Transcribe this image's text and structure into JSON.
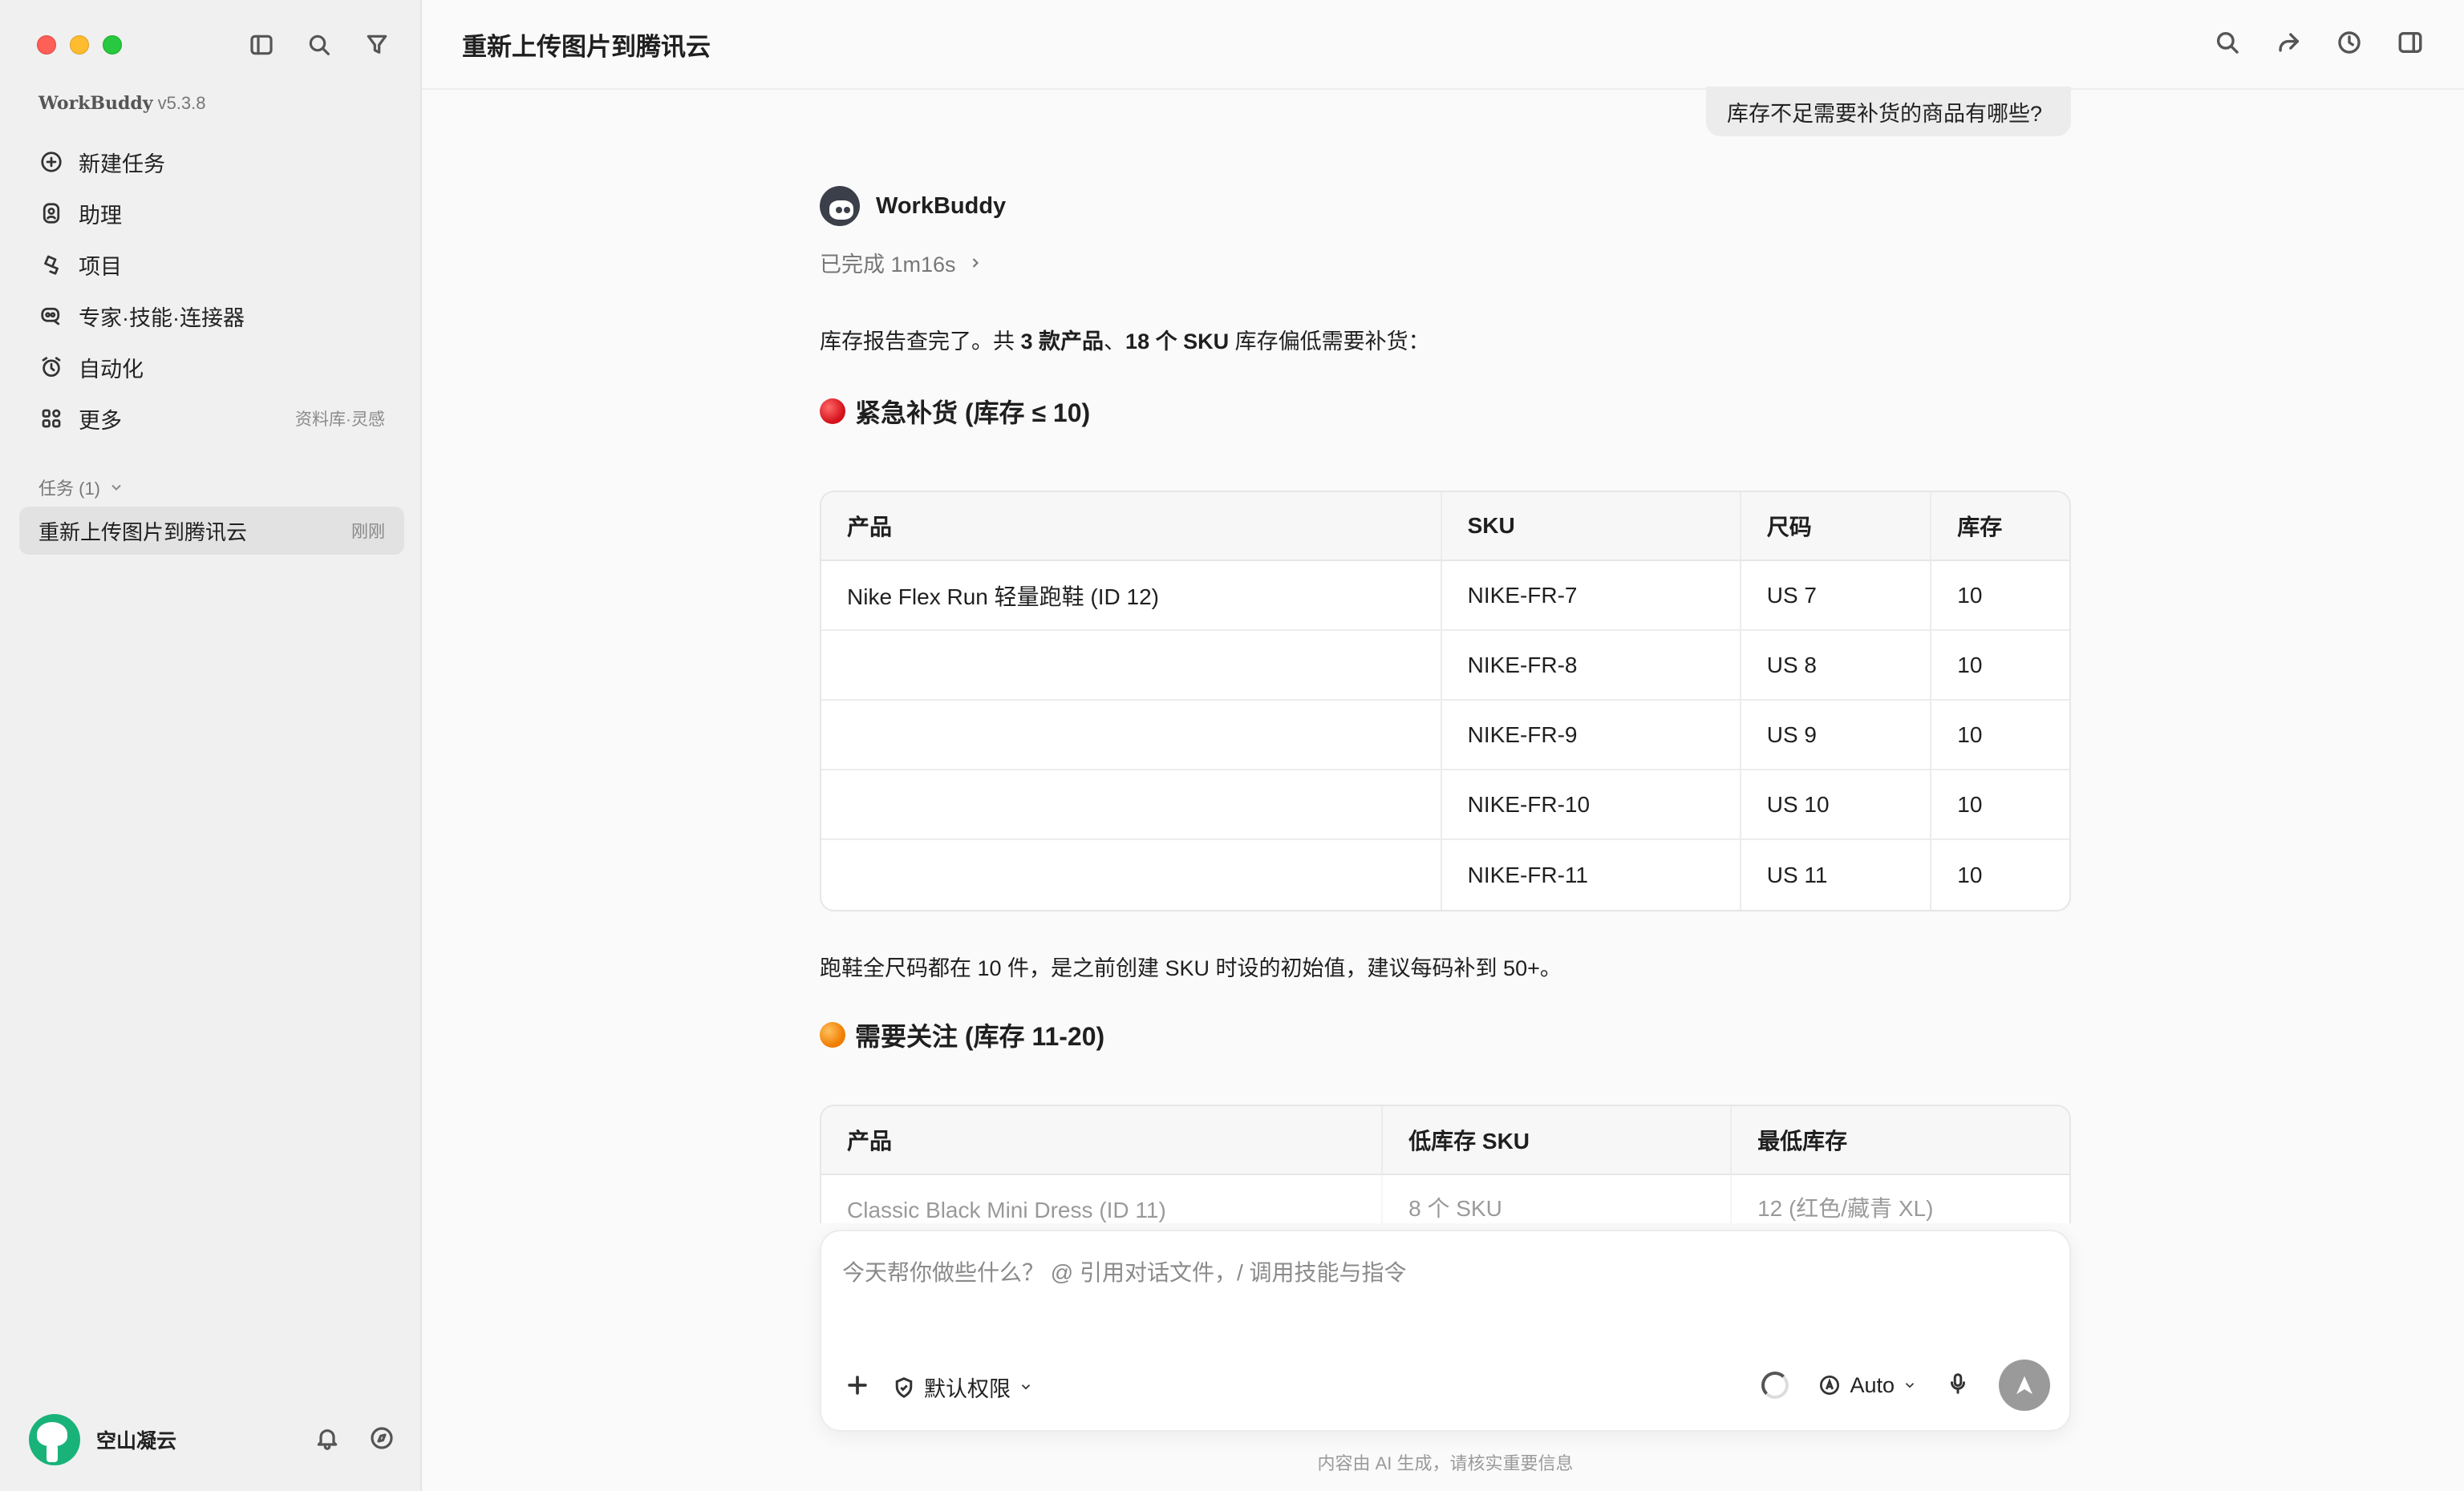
{
  "window": {
    "title": "重新上传图片到腾讯云"
  },
  "sidebar": {
    "brand": "WorkBuddy",
    "version": "v5.3.8",
    "nav": [
      {
        "label": "新建任务",
        "icon": "plus-circle-icon"
      },
      {
        "label": "助理",
        "icon": "assistant-icon"
      },
      {
        "label": "项目",
        "icon": "project-icon"
      },
      {
        "label": "专家·技能·连接器",
        "icon": "expert-icon"
      },
      {
        "label": "自动化",
        "icon": "alarm-clock-icon"
      },
      {
        "label": "更多",
        "icon": "apps-icon",
        "note": "资料库·灵感"
      }
    ],
    "tasks_header": "任务 (1)",
    "tasks": [
      {
        "label": "重新上传图片到腾讯云",
        "time": "刚刚"
      }
    ],
    "user": {
      "name": "空山凝云"
    }
  },
  "chat": {
    "user_message": "库存不足需要补货的商品有哪些?",
    "bot_name": "WorkBuddy",
    "status": "已完成 1m16s",
    "intro": {
      "pre": "库存报告查完了。共 ",
      "b1": "3 款产品",
      "mid": "、",
      "b2": "18 个 SKU",
      "post": " 库存偏低需要补货："
    },
    "section1": {
      "title": "紧急补货 (库存 ≤ 10)",
      "headers": [
        "产品",
        "SKU",
        "尺码",
        "库存"
      ],
      "rows": [
        [
          "Nike Flex Run 轻量跑鞋 (ID 12)",
          "NIKE-FR-7",
          "US 7",
          "10"
        ],
        [
          "",
          "NIKE-FR-8",
          "US 8",
          "10"
        ],
        [
          "",
          "NIKE-FR-9",
          "US 9",
          "10"
        ],
        [
          "",
          "NIKE-FR-10",
          "US 10",
          "10"
        ],
        [
          "",
          "NIKE-FR-11",
          "US 11",
          "10"
        ]
      ]
    },
    "note": "跑鞋全尺码都在 10 件，是之前创建 SKU 时设的初始值，建议每码补到 50+。",
    "section2": {
      "title": "需要关注 (库存 11-20)",
      "headers": [
        "产品",
        "低库存 SKU",
        "最低库存"
      ],
      "rows": [
        [
          "Classic Black Mini Dress (ID 11)",
          "8 个 SKU",
          "12 (红色/藏青 XL)"
        ]
      ]
    }
  },
  "composer": {
    "placeholder": "今天帮你做些什么？ @ 引用对话文件，/ 调用技能与指令",
    "permission": "默认权限",
    "model": "Auto"
  },
  "disclaimer": "内容由 AI 生成，请核实重要信息",
  "colors": {
    "urgent": "#d4101a",
    "attention": "#f07c00",
    "send": "#9a9a9a"
  }
}
